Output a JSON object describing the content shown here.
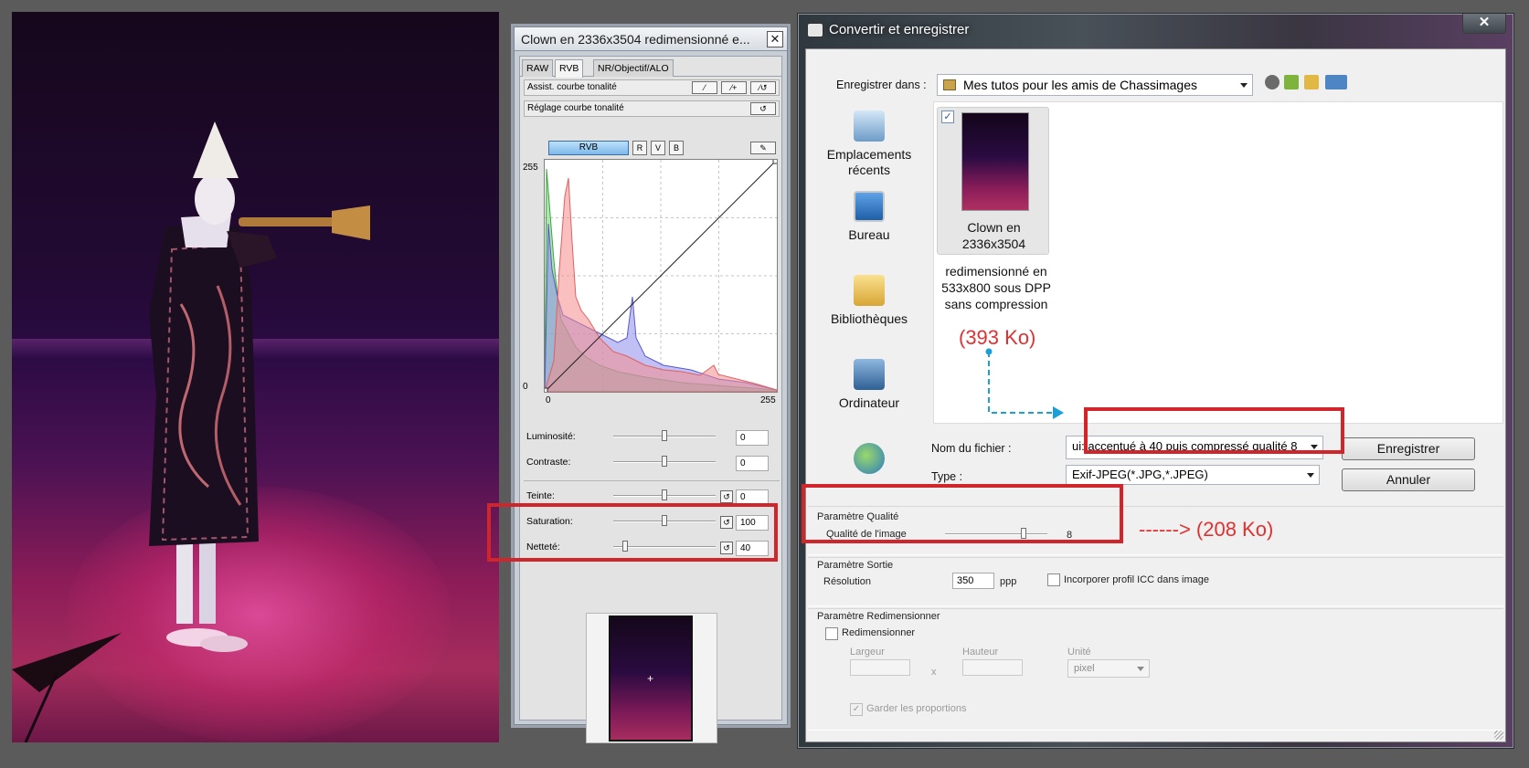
{
  "tool_palette": {
    "title": "Clown en 2336x3504 redimensionné e...",
    "close": "✕",
    "tabs": [
      "RAW",
      "RVB",
      "NR/Objectif/ALO"
    ],
    "active_tab": "RVB",
    "tone_curve_assist": "Assist. courbe tonalité",
    "tone_curve_adjust": "Réglage courbe tonalité",
    "channel_button": "RVB",
    "channels": [
      "R",
      "V",
      "B"
    ],
    "y_max": "255",
    "y_min": "0",
    "x_min": "0",
    "x_max": "255",
    "adjustments": [
      {
        "label": "Luminosité:",
        "value": "0",
        "level": 0.5
      },
      {
        "label": "Contraste:",
        "value": "0",
        "level": 0.5
      },
      {
        "label": "Teinte:",
        "value": "0",
        "level": 0.5
      },
      {
        "label": "Saturation:",
        "value": "100",
        "level": 0.5
      },
      {
        "label": "Netteté:",
        "value": "40",
        "level": 0.1
      }
    ]
  },
  "save_dialog": {
    "title": "Convertir et enregistrer",
    "close": "✕",
    "save_in_label": "Enregistrer dans :",
    "save_in_value": "Mes tutos pour les amis de Chassimages",
    "places": [
      {
        "label": "Emplacements récents",
        "icon": "recent-places-icon"
      },
      {
        "label": "Bureau",
        "icon": "desktop-icon"
      },
      {
        "label": "Bibliothèques",
        "icon": "libraries-icon"
      },
      {
        "label": "Ordinateur",
        "icon": "computer-icon"
      },
      {
        "label": "",
        "icon": "network-icon"
      }
    ],
    "file_item": {
      "name_line1": "Clown en",
      "name_line2": "2336x3504",
      "name_rest": "redimensionné en 533x800 sous DPP sans compression",
      "checked": "✓"
    },
    "size_before": "(393 Ko)",
    "size_after": "------> (208 Ko)",
    "filename_label": "Nom du fichier :",
    "filename_value": "ui: accentué à 40 puis compressé qualité 8",
    "type_label": "Type :",
    "type_value": "Exif-JPEG(*.JPG,*.JPEG)",
    "save_button": "Enregistrer",
    "cancel_button": "Annuler",
    "quality_group": "Paramètre Qualité",
    "quality_label": "Qualité de l'image",
    "quality_value": "8",
    "quality_level": 0.8,
    "output_group": "Paramètre Sortie",
    "resolution_label": "Résolution",
    "resolution_value": "350",
    "resolution_unit": "ppp",
    "icc_label": "Incorporer profil ICC dans image",
    "resize_group": "Paramètre Redimensionner",
    "resize_label": "Redimensionner",
    "width_label": "Largeur",
    "height_label": "Hauteur",
    "times": "x",
    "unit_label": "Unité",
    "unit_value": "pixel",
    "keep_ratio_label": "Garder les proportions",
    "keep_ratio_checked": "✓"
  }
}
